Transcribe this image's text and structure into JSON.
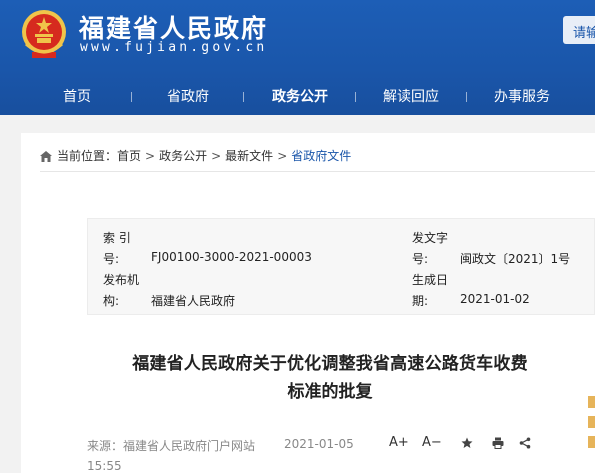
{
  "header": {
    "site_title": "福建省人民政府",
    "site_url": "www.fujian.gov.cn",
    "top_button": "请输",
    "colors": {
      "header_blue": "#1a56aa",
      "link_blue": "#1a56aa",
      "gold": "#f0c44a",
      "red": "#d62a1e"
    }
  },
  "nav": {
    "items": [
      {
        "label": "首页"
      },
      {
        "label": "省政府"
      },
      {
        "label": "政务公开",
        "active": true
      },
      {
        "label": "解读回应"
      },
      {
        "label": "办事服务"
      }
    ]
  },
  "breadcrumb": {
    "prefix": "当前位置：",
    "items": [
      "首页",
      "政务公开",
      "最新文件",
      "省政府文件"
    ],
    "separator": ">"
  },
  "meta": {
    "index_label_1": "索 引",
    "index_label_2": "号:",
    "index_value": "FJ00100-3000-2021-00003",
    "docno_label_1": "发文字",
    "docno_label_2": "号:",
    "docno_value": "闽政文〔2021〕1号",
    "issuer_label_1": "发布机",
    "issuer_label_2": "构:",
    "issuer_value": "福建省人民政府",
    "date_label_1": "生成日",
    "date_label_2": "期:",
    "date_value": "2021-01-02"
  },
  "doc": {
    "title_line1": "福建省人民政府关于优化调整我省高速公路货车收费",
    "title_line2": "标准的批复"
  },
  "source": {
    "label": "来源：福建省人民政府门户网站",
    "date": "2021-01-05",
    "time": "15:55",
    "tools": {
      "font_plus": "A+",
      "font_minus": "A−"
    }
  }
}
